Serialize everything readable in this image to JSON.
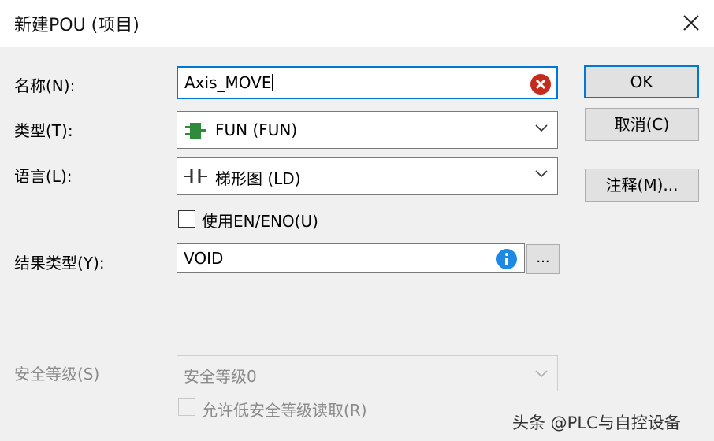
{
  "window": {
    "title": "新建POU (项目)"
  },
  "form": {
    "name": {
      "label": "名称(N):",
      "value": "Axis_MOVE"
    },
    "type": {
      "label": "类型(T):",
      "value": "FUN (FUN)",
      "icon": "function-block-icon"
    },
    "language": {
      "label": "语言(L):",
      "value": "梯形图 (LD)",
      "icon": "ladder-contact-icon"
    },
    "use_en_eno": {
      "label": "使用EN/ENO(U)",
      "checked": false
    },
    "result_type": {
      "label": "结果类型(Y):",
      "value": "VOID",
      "browse_label": "..."
    },
    "safety_level": {
      "label": "安全等级(S)",
      "value": "安全等级0",
      "enabled": false
    },
    "allow_low_safety": {
      "label": "允许低安全等级读取(R)",
      "checked": false,
      "enabled": false
    }
  },
  "buttons": {
    "ok": "OK",
    "cancel": "取消(C)",
    "comment": "注释(M)..."
  },
  "watermark": "头条 @PLC与自控设备",
  "colors": {
    "accent": "#0078d7",
    "error": "#c42b1c",
    "info": "#1e88e5",
    "fun_icon": "#2e8b3a"
  }
}
